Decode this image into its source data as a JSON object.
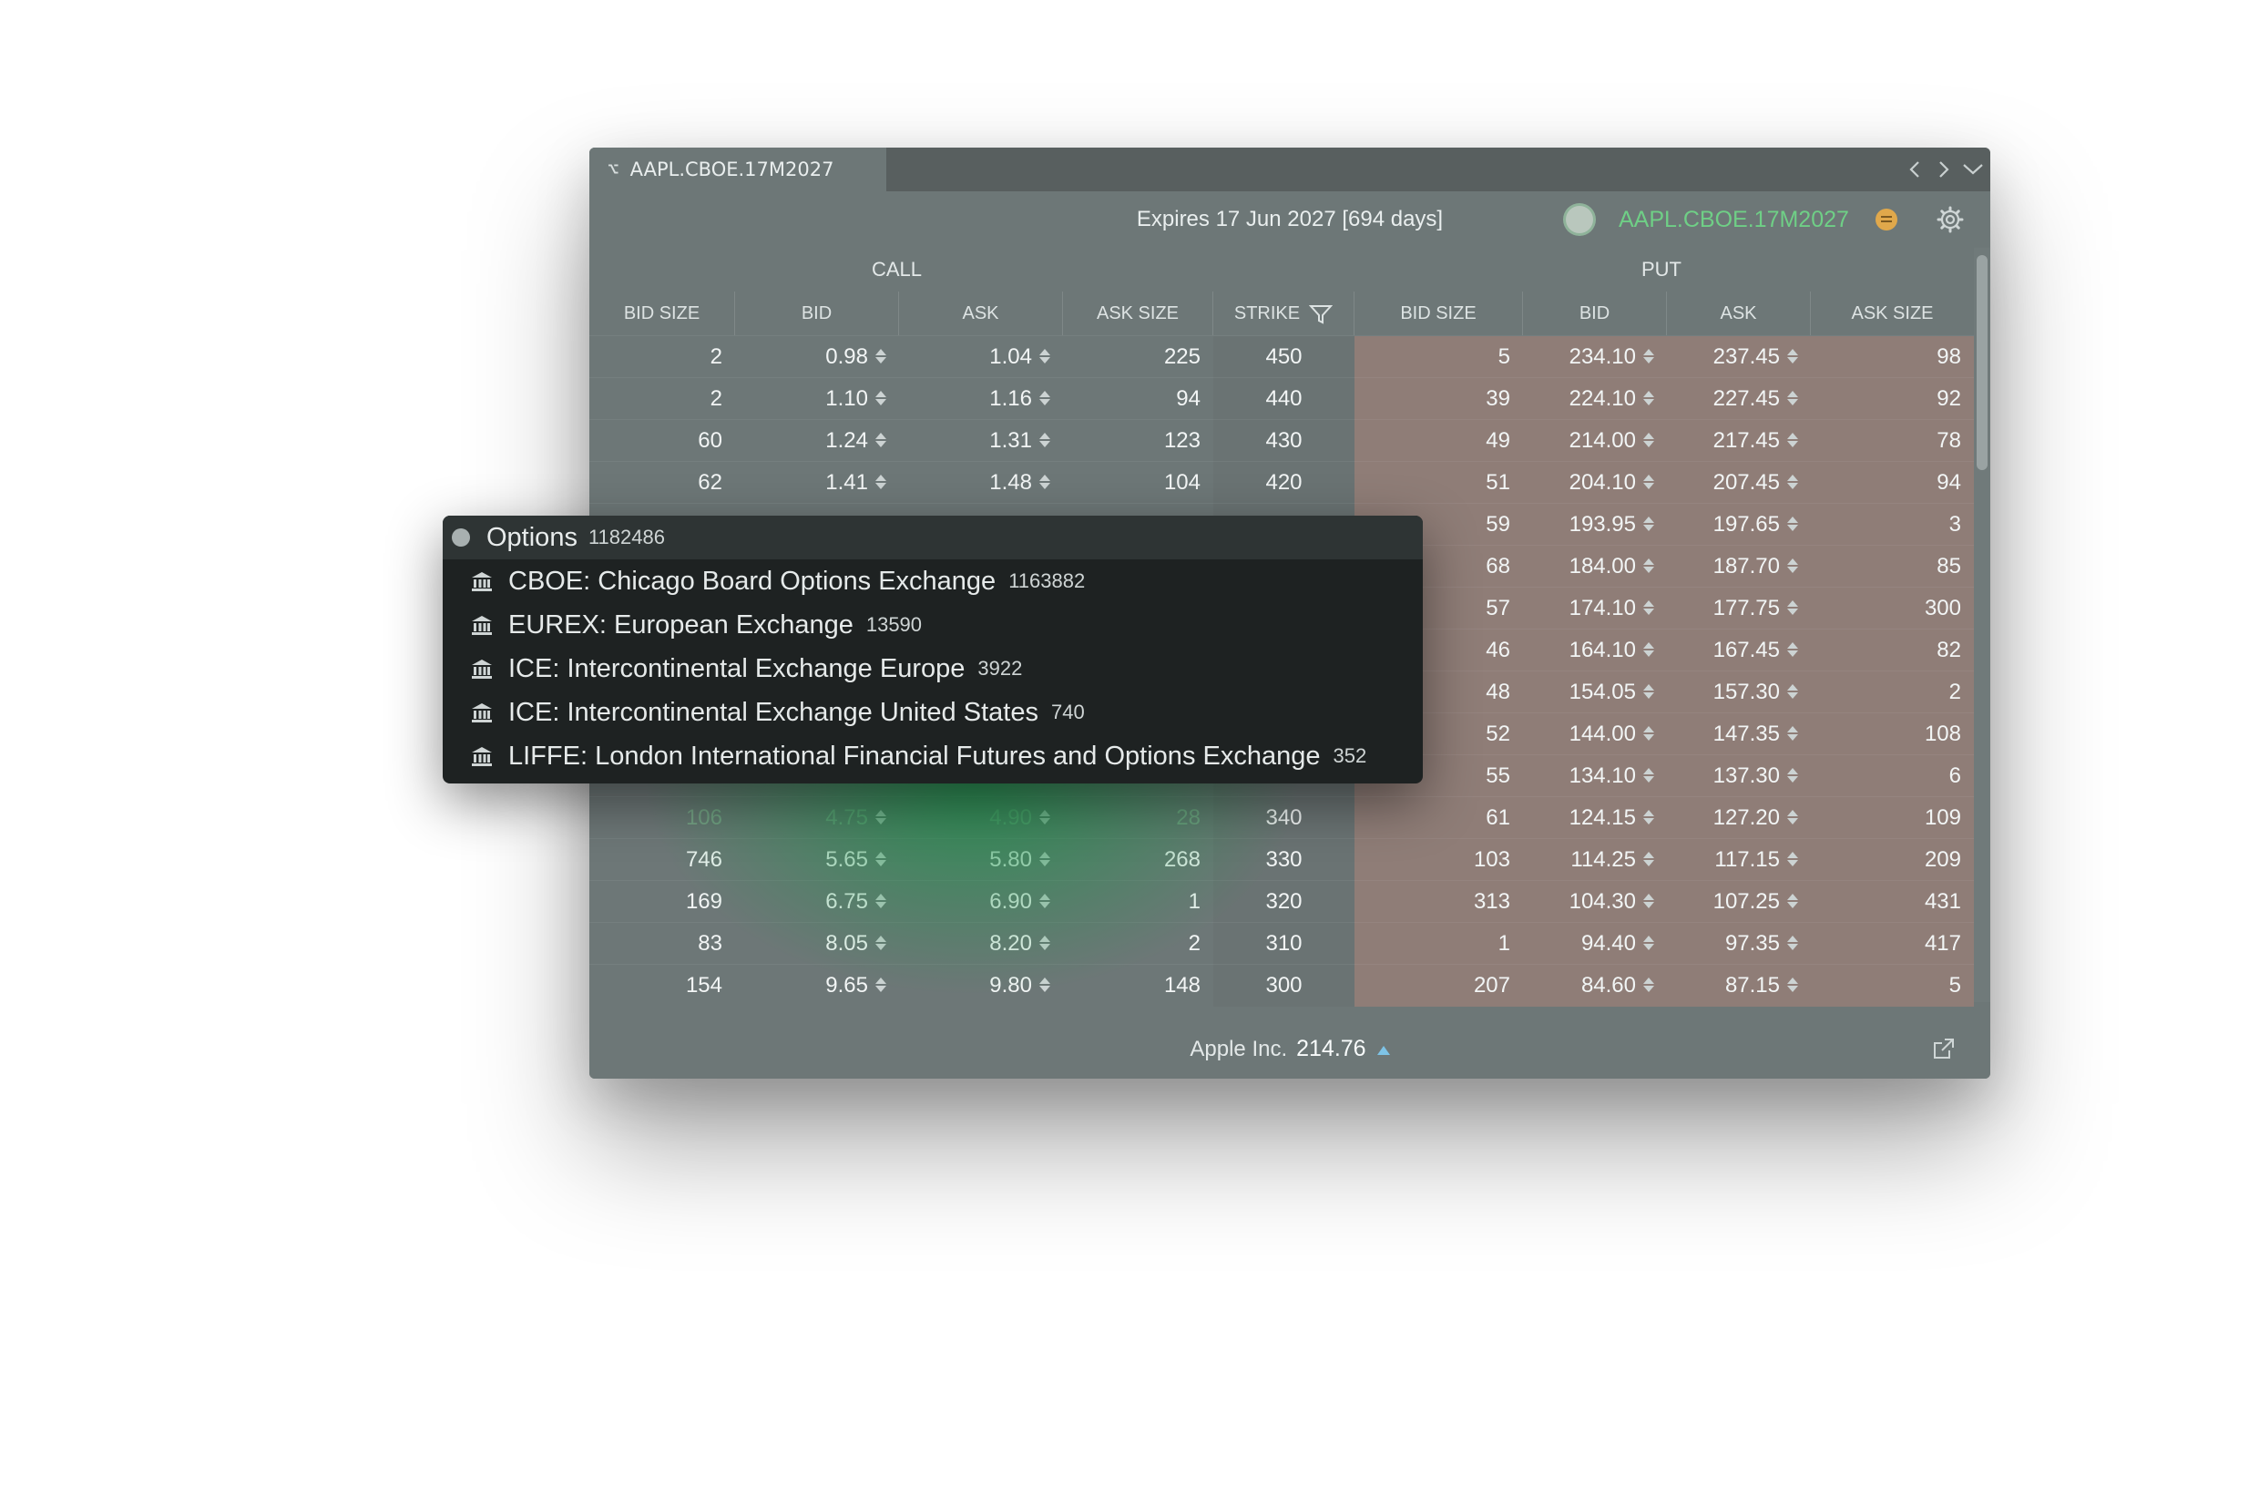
{
  "tab": {
    "icon": "option-symbol-icon",
    "title": "AAPL.CBOE.17M2027"
  },
  "nav": {
    "prev": "chevron-left-icon",
    "next": "chevron-right-icon",
    "menu": "chevron-down-icon"
  },
  "header": {
    "expires": "Expires 17 Jun 2027 [694 days]",
    "symbol": "AAPL.CBOE.17M2027",
    "symbol_color": "#6fcf86"
  },
  "groups": {
    "call": "CALL",
    "put": "PUT"
  },
  "columns": [
    "BID SIZE",
    "BID",
    "ASK",
    "ASK SIZE",
    "STRIKE",
    "BID SIZE",
    "BID",
    "ASK",
    "ASK SIZE"
  ],
  "rows": [
    {
      "cbs": "2",
      "cb": "0.98",
      "ca": "1.04",
      "cas": "225",
      "strike": "450",
      "pbs": "5",
      "pb": "234.10",
      "pa": "237.45",
      "pas": "98"
    },
    {
      "cbs": "2",
      "cb": "1.10",
      "ca": "1.16",
      "cas": "94",
      "strike": "440",
      "pbs": "39",
      "pb": "224.10",
      "pa": "227.45",
      "pas": "92"
    },
    {
      "cbs": "60",
      "cb": "1.24",
      "ca": "1.31",
      "cas": "123",
      "strike": "430",
      "pbs": "49",
      "pb": "214.00",
      "pa": "217.45",
      "pas": "78"
    },
    {
      "cbs": "62",
      "cb": "1.41",
      "ca": "1.48",
      "cas": "104",
      "strike": "420",
      "pbs": "51",
      "pb": "204.10",
      "pa": "207.45",
      "pas": "94"
    },
    {
      "cbs": "",
      "cb": "",
      "ca": "",
      "cas": "",
      "strike": "",
      "pbs": "59",
      "pb": "193.95",
      "pa": "197.65",
      "pas": "3"
    },
    {
      "cbs": "",
      "cb": "",
      "ca": "",
      "cas": "",
      "strike": "",
      "pbs": "68",
      "pb": "184.00",
      "pa": "187.70",
      "pas": "85"
    },
    {
      "cbs": "",
      "cb": "",
      "ca": "",
      "cas": "",
      "strike": "",
      "pbs": "57",
      "pb": "174.10",
      "pa": "177.75",
      "pas": "300"
    },
    {
      "cbs": "",
      "cb": "",
      "ca": "",
      "cas": "",
      "strike": "",
      "pbs": "46",
      "pb": "164.10",
      "pa": "167.45",
      "pas": "82"
    },
    {
      "cbs": "",
      "cb": "",
      "ca": "",
      "cas": "",
      "strike": "",
      "pbs": "48",
      "pb": "154.05",
      "pa": "157.30",
      "pas": "2"
    },
    {
      "cbs": "",
      "cb": "",
      "ca": "",
      "cas": "",
      "strike": "",
      "pbs": "52",
      "pb": "144.00",
      "pa": "147.35",
      "pas": "108"
    },
    {
      "cbs": "",
      "cb": "",
      "ca": "",
      "cas": "",
      "strike": "",
      "pbs": "55",
      "pb": "134.10",
      "pa": "137.30",
      "pas": "6"
    },
    {
      "cbs": "106",
      "cb": "4.75",
      "ca": "4.90",
      "cas": "28",
      "strike": "340",
      "pbs": "61",
      "pb": "124.15",
      "pa": "127.20",
      "pas": "109",
      "faded": true
    },
    {
      "cbs": "746",
      "cb": "5.65",
      "ca": "5.80",
      "cas": "268",
      "strike": "330",
      "pbs": "103",
      "pb": "114.25",
      "pa": "117.15",
      "pas": "209"
    },
    {
      "cbs": "169",
      "cb": "6.75",
      "ca": "6.90",
      "cas": "1",
      "strike": "320",
      "pbs": "313",
      "pb": "104.30",
      "pa": "107.25",
      "pas": "431"
    },
    {
      "cbs": "83",
      "cb": "8.05",
      "ca": "8.20",
      "cas": "2",
      "strike": "310",
      "pbs": "1",
      "pb": "94.40",
      "pa": "97.35",
      "pas": "417"
    },
    {
      "cbs": "154",
      "cb": "9.65",
      "ca": "9.80",
      "cas": "148",
      "strike": "300",
      "pbs": "207",
      "pb": "84.60",
      "pa": "87.15",
      "pas": "5"
    }
  ],
  "footer": {
    "name": "Apple Inc.",
    "price": "214.76",
    "trend_icon": "triangle-up-icon"
  },
  "dropdown": {
    "header": {
      "label": "Options",
      "count": "1182486"
    },
    "items": [
      {
        "label": "CBOE: Chicago Board Options Exchange",
        "count": "1163882",
        "icon": "bank-icon"
      },
      {
        "label": "EUREX: European Exchange",
        "count": "13590",
        "icon": "bank-icon"
      },
      {
        "label": "ICE: Intercontinental Exchange Europe",
        "count": "3922",
        "icon": "bank-icon"
      },
      {
        "label": "ICE: Intercontinental Exchange United States",
        "count": "740",
        "icon": "bank-icon"
      },
      {
        "label": "LIFFE: London International Financial Futures and Options Exchange",
        "count": "352",
        "icon": "bank-icon"
      }
    ]
  }
}
